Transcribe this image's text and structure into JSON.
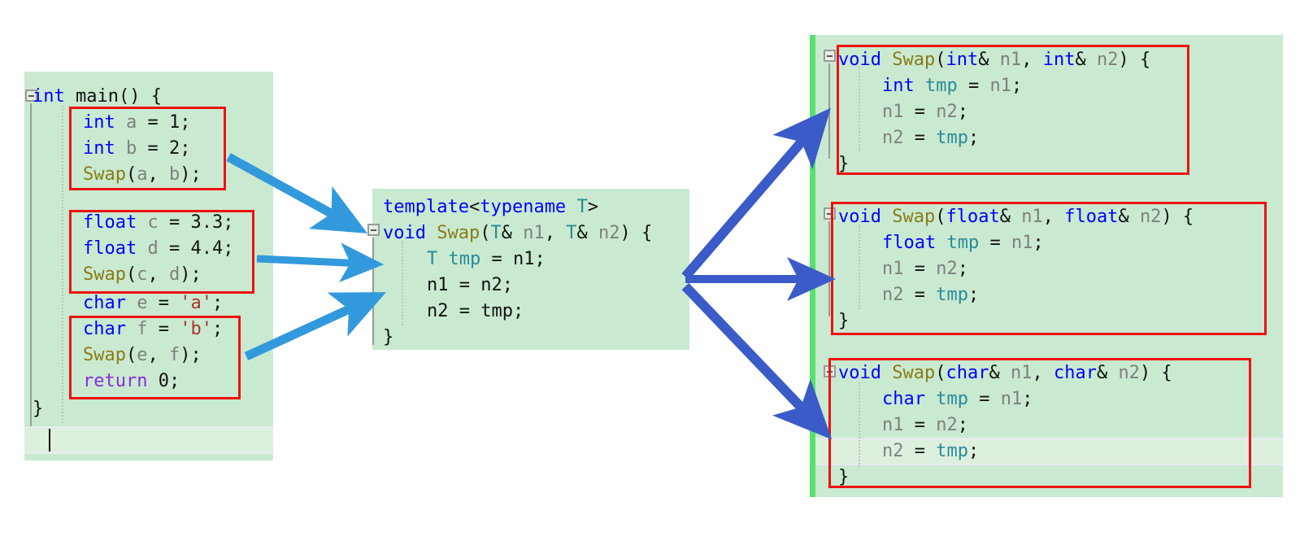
{
  "diagram": {
    "title": "C++ function template instantiation diagram",
    "colors": {
      "editor_background": "#c9ead0",
      "highlight_row": "#ddf0de",
      "red_box_border": "#ee1111",
      "left_arrow": "#3399dd",
      "right_arrow": "#3a5bc8",
      "change_marker_green": "#57e26d",
      "keyword_blue": "#0000ff",
      "function_olive": "#8a7b18",
      "variable_gray": "#808080",
      "type_teal": "#2b8a99",
      "string_red": "#b03030",
      "return_purple": "#8a2be2"
    }
  },
  "left_panel": {
    "name": "main-function-editor",
    "lines": [
      {
        "id": "l0",
        "indent": 0,
        "tokens": [
          {
            "t": "int",
            "c": "kw"
          },
          {
            "t": " main() {",
            "c": "pun"
          }
        ]
      },
      {
        "id": "l1",
        "indent": 1,
        "tokens": [
          {
            "t": "int",
            "c": "kw"
          },
          {
            "t": " ",
            "c": "pun"
          },
          {
            "t": "a",
            "c": "var"
          },
          {
            "t": " = ",
            "c": "pun"
          },
          {
            "t": "1",
            "c": "num"
          },
          {
            "t": ";",
            "c": "pun"
          }
        ]
      },
      {
        "id": "l2",
        "indent": 1,
        "tokens": [
          {
            "t": "int",
            "c": "kw"
          },
          {
            "t": " ",
            "c": "pun"
          },
          {
            "t": "b",
            "c": "var"
          },
          {
            "t": " = ",
            "c": "pun"
          },
          {
            "t": "2",
            "c": "num"
          },
          {
            "t": ";",
            "c": "pun"
          }
        ]
      },
      {
        "id": "l3",
        "indent": 1,
        "tokens": [
          {
            "t": "Swap",
            "c": "fn"
          },
          {
            "t": "(",
            "c": "pun"
          },
          {
            "t": "a",
            "c": "var"
          },
          {
            "t": ", ",
            "c": "pun"
          },
          {
            "t": "b",
            "c": "var"
          },
          {
            "t": ");",
            "c": "pun"
          }
        ]
      },
      {
        "id": "l4",
        "indent": 1,
        "tokens": [
          {
            "t": "float",
            "c": "kw"
          },
          {
            "t": " ",
            "c": "pun"
          },
          {
            "t": "c",
            "c": "var"
          },
          {
            "t": " = ",
            "c": "pun"
          },
          {
            "t": "3.3",
            "c": "num"
          },
          {
            "t": ";",
            "c": "pun"
          }
        ]
      },
      {
        "id": "l5",
        "indent": 1,
        "tokens": [
          {
            "t": "float",
            "c": "kw"
          },
          {
            "t": " ",
            "c": "pun"
          },
          {
            "t": "d",
            "c": "var"
          },
          {
            "t": " = ",
            "c": "pun"
          },
          {
            "t": "4.4",
            "c": "num"
          },
          {
            "t": ";",
            "c": "pun"
          }
        ]
      },
      {
        "id": "l6",
        "indent": 1,
        "tokens": [
          {
            "t": "Swap",
            "c": "fn"
          },
          {
            "t": "(",
            "c": "pun"
          },
          {
            "t": "c",
            "c": "var"
          },
          {
            "t": ", ",
            "c": "pun"
          },
          {
            "t": "d",
            "c": "var"
          },
          {
            "t": ");",
            "c": "pun"
          }
        ]
      },
      {
        "id": "l7",
        "indent": 1,
        "tokens": [
          {
            "t": "char",
            "c": "kw"
          },
          {
            "t": " ",
            "c": "pun"
          },
          {
            "t": "e",
            "c": "var"
          },
          {
            "t": " = ",
            "c": "pun"
          },
          {
            "t": "'a'",
            "c": "str"
          },
          {
            "t": ";",
            "c": "pun"
          }
        ]
      },
      {
        "id": "l8",
        "indent": 1,
        "tokens": [
          {
            "t": "char",
            "c": "kw"
          },
          {
            "t": " ",
            "c": "pun"
          },
          {
            "t": "f",
            "c": "var"
          },
          {
            "t": " = ",
            "c": "pun"
          },
          {
            "t": "'b'",
            "c": "str"
          },
          {
            "t": ";",
            "c": "pun"
          }
        ]
      },
      {
        "id": "l9",
        "indent": 1,
        "tokens": [
          {
            "t": "Swap",
            "c": "fn"
          },
          {
            "t": "(",
            "c": "pun"
          },
          {
            "t": "e",
            "c": "var"
          },
          {
            "t": ", ",
            "c": "pun"
          },
          {
            "t": "f",
            "c": "var"
          },
          {
            "t": ");",
            "c": "pun"
          }
        ]
      },
      {
        "id": "l10",
        "indent": 1,
        "tokens": [
          {
            "t": "return",
            "c": "ret"
          },
          {
            "t": " ",
            "c": "pun"
          },
          {
            "t": "0",
            "c": "num"
          },
          {
            "t": ";",
            "c": "pun"
          }
        ]
      },
      {
        "id": "l11",
        "indent": 0,
        "tokens": [
          {
            "t": "}",
            "c": "pun"
          }
        ]
      }
    ],
    "plain_text": [
      "int main() {",
      "    int a = 1;",
      "    int b = 2;",
      "    Swap(a, b);",
      "    float c = 3.3;",
      "    float d = 4.4;",
      "    Swap(c, d);",
      "    char e = 'a';",
      "    char f = 'b';",
      "    Swap(e, f);",
      "    return 0;",
      "}"
    ],
    "highlight_boxes": [
      {
        "name": "int-call-group",
        "label": "int a = 1; int b = 2; Swap(a, b);"
      },
      {
        "name": "float-call-group",
        "label": "float c = 3.3; float d = 4.4; Swap(c, d);"
      },
      {
        "name": "char-call-group",
        "label": "char e = 'a'; char f = 'b'; Swap(e, f);"
      }
    ]
  },
  "center_panel": {
    "name": "swap-template-editor",
    "lines": [
      {
        "id": "c0",
        "indent": 0,
        "tokens": [
          {
            "t": "template",
            "c": "kw"
          },
          {
            "t": "<",
            "c": "pun"
          },
          {
            "t": "typename",
            "c": "kw"
          },
          {
            "t": " ",
            "c": "pun"
          },
          {
            "t": "T",
            "c": "type"
          },
          {
            "t": ">",
            "c": "pun"
          }
        ]
      },
      {
        "id": "c1",
        "indent": 0,
        "tokens": [
          {
            "t": "void",
            "c": "kw"
          },
          {
            "t": " ",
            "c": "pun"
          },
          {
            "t": "Swap",
            "c": "fn"
          },
          {
            "t": "(",
            "c": "pun"
          },
          {
            "t": "T",
            "c": "type"
          },
          {
            "t": "& ",
            "c": "pun"
          },
          {
            "t": "n1",
            "c": "var"
          },
          {
            "t": ", ",
            "c": "pun"
          },
          {
            "t": "T",
            "c": "type"
          },
          {
            "t": "& ",
            "c": "pun"
          },
          {
            "t": "n2",
            "c": "var"
          },
          {
            "t": ") {",
            "c": "pun"
          }
        ]
      },
      {
        "id": "c2",
        "indent": 1,
        "tokens": [
          {
            "t": "T",
            "c": "type"
          },
          {
            "t": " ",
            "c": "pun"
          },
          {
            "t": "tmp",
            "c": "type"
          },
          {
            "t": " = ",
            "c": "pun"
          },
          {
            "t": "n1",
            "c": "pun"
          },
          {
            "t": ";",
            "c": "pun"
          }
        ]
      },
      {
        "id": "c3",
        "indent": 1,
        "tokens": [
          {
            "t": "n1",
            "c": "pun"
          },
          {
            "t": " = ",
            "c": "pun"
          },
          {
            "t": "n2",
            "c": "pun"
          },
          {
            "t": ";",
            "c": "pun"
          }
        ]
      },
      {
        "id": "c4",
        "indent": 1,
        "tokens": [
          {
            "t": "n2",
            "c": "pun"
          },
          {
            "t": " = ",
            "c": "pun"
          },
          {
            "t": "tmp",
            "c": "pun"
          },
          {
            "t": ";",
            "c": "pun"
          }
        ]
      },
      {
        "id": "c5",
        "indent": 0,
        "tokens": [
          {
            "t": "}",
            "c": "pun"
          }
        ]
      }
    ],
    "plain_text": [
      "template<typename T>",
      "void Swap(T& n1, T& n2) {",
      "    T tmp = n1;",
      "    n1 = n2;",
      "    n2 = tmp;",
      "}"
    ]
  },
  "right_panel": {
    "name": "instantiated-functions-editor",
    "blocks": [
      {
        "name": "swap-int-instantiation",
        "type_name": "int",
        "lines": [
          {
            "id": "r0a",
            "indent": 0,
            "tokens": [
              {
                "t": "void",
                "c": "kw"
              },
              {
                "t": " ",
                "c": "pun"
              },
              {
                "t": "Swap",
                "c": "fn"
              },
              {
                "t": "(",
                "c": "pun"
              },
              {
                "t": "int",
                "c": "kw"
              },
              {
                "t": "& ",
                "c": "pun"
              },
              {
                "t": "n1",
                "c": "var"
              },
              {
                "t": ", ",
                "c": "pun"
              },
              {
                "t": "int",
                "c": "kw"
              },
              {
                "t": "& ",
                "c": "pun"
              },
              {
                "t": "n2",
                "c": "var"
              },
              {
                "t": ") {",
                "c": "pun"
              }
            ]
          },
          {
            "id": "r0b",
            "indent": 1,
            "tokens": [
              {
                "t": "int",
                "c": "kw"
              },
              {
                "t": " ",
                "c": "pun"
              },
              {
                "t": "tmp",
                "c": "type"
              },
              {
                "t": " = ",
                "c": "pun"
              },
              {
                "t": "n1",
                "c": "var"
              },
              {
                "t": ";",
                "c": "pun"
              }
            ]
          },
          {
            "id": "r0c",
            "indent": 1,
            "tokens": [
              {
                "t": "n1",
                "c": "var"
              },
              {
                "t": " = ",
                "c": "pun"
              },
              {
                "t": "n2",
                "c": "var"
              },
              {
                "t": ";",
                "c": "pun"
              }
            ]
          },
          {
            "id": "r0d",
            "indent": 1,
            "tokens": [
              {
                "t": "n2",
                "c": "var"
              },
              {
                "t": " = ",
                "c": "pun"
              },
              {
                "t": "tmp",
                "c": "type"
              },
              {
                "t": ";",
                "c": "pun"
              }
            ]
          },
          {
            "id": "r0e",
            "indent": 0,
            "tokens": [
              {
                "t": "}",
                "c": "pun"
              }
            ]
          }
        ],
        "plain_text": [
          "void Swap(int& n1, int& n2) {",
          "    int tmp = n1;",
          "    n1 = n2;",
          "    n2 = tmp;",
          "}"
        ]
      },
      {
        "name": "swap-float-instantiation",
        "type_name": "float",
        "lines": [
          {
            "id": "r1a",
            "indent": 0,
            "tokens": [
              {
                "t": "void",
                "c": "kw"
              },
              {
                "t": " ",
                "c": "pun"
              },
              {
                "t": "Swap",
                "c": "fn"
              },
              {
                "t": "(",
                "c": "pun"
              },
              {
                "t": "float",
                "c": "kw"
              },
              {
                "t": "& ",
                "c": "pun"
              },
              {
                "t": "n1",
                "c": "var"
              },
              {
                "t": ", ",
                "c": "pun"
              },
              {
                "t": "float",
                "c": "kw"
              },
              {
                "t": "& ",
                "c": "pun"
              },
              {
                "t": "n2",
                "c": "var"
              },
              {
                "t": ") {",
                "c": "pun"
              }
            ]
          },
          {
            "id": "r1b",
            "indent": 1,
            "tokens": [
              {
                "t": "float",
                "c": "kw"
              },
              {
                "t": " ",
                "c": "pun"
              },
              {
                "t": "tmp",
                "c": "type"
              },
              {
                "t": " = ",
                "c": "pun"
              },
              {
                "t": "n1",
                "c": "var"
              },
              {
                "t": ";",
                "c": "pun"
              }
            ]
          },
          {
            "id": "r1c",
            "indent": 1,
            "tokens": [
              {
                "t": "n1",
                "c": "var"
              },
              {
                "t": " = ",
                "c": "pun"
              },
              {
                "t": "n2",
                "c": "var"
              },
              {
                "t": ";",
                "c": "pun"
              }
            ]
          },
          {
            "id": "r1d",
            "indent": 1,
            "tokens": [
              {
                "t": "n2",
                "c": "var"
              },
              {
                "t": " = ",
                "c": "pun"
              },
              {
                "t": "tmp",
                "c": "type"
              },
              {
                "t": ";",
                "c": "pun"
              }
            ]
          },
          {
            "id": "r1e",
            "indent": 0,
            "tokens": [
              {
                "t": "}",
                "c": "pun"
              }
            ]
          }
        ],
        "plain_text": [
          "void Swap(float& n1, float& n2) {",
          "    float tmp = n1;",
          "    n1 = n2;",
          "    n2 = tmp;",
          "}"
        ]
      },
      {
        "name": "swap-char-instantiation",
        "type_name": "char",
        "highlighted_line_id": "r2d",
        "lines": [
          {
            "id": "r2a",
            "indent": 0,
            "tokens": [
              {
                "t": "void",
                "c": "kw"
              },
              {
                "t": " ",
                "c": "pun"
              },
              {
                "t": "Swap",
                "c": "fn"
              },
              {
                "t": "(",
                "c": "pun"
              },
              {
                "t": "char",
                "c": "kw"
              },
              {
                "t": "& ",
                "c": "pun"
              },
              {
                "t": "n1",
                "c": "var"
              },
              {
                "t": ", ",
                "c": "pun"
              },
              {
                "t": "char",
                "c": "kw"
              },
              {
                "t": "& ",
                "c": "pun"
              },
              {
                "t": "n2",
                "c": "var"
              },
              {
                "t": ") {",
                "c": "pun"
              }
            ]
          },
          {
            "id": "r2b",
            "indent": 1,
            "tokens": [
              {
                "t": "char",
                "c": "kw"
              },
              {
                "t": " ",
                "c": "pun"
              },
              {
                "t": "tmp",
                "c": "type"
              },
              {
                "t": " = ",
                "c": "pun"
              },
              {
                "t": "n1",
                "c": "var"
              },
              {
                "t": ";",
                "c": "pun"
              }
            ]
          },
          {
            "id": "r2c",
            "indent": 1,
            "tokens": [
              {
                "t": "n1",
                "c": "var"
              },
              {
                "t": " = ",
                "c": "pun"
              },
              {
                "t": "n2",
                "c": "var"
              },
              {
                "t": ";",
                "c": "pun"
              }
            ]
          },
          {
            "id": "r2d",
            "indent": 1,
            "tokens": [
              {
                "t": "n2",
                "c": "var"
              },
              {
                "t": " = ",
                "c": "pun"
              },
              {
                "t": "tmp",
                "c": "type"
              },
              {
                "t": ";",
                "c": "pun"
              }
            ]
          },
          {
            "id": "r2e",
            "indent": 0,
            "tokens": [
              {
                "t": "}",
                "c": "pun"
              }
            ]
          }
        ],
        "plain_text": [
          "void Swap(char& n1, char& n2) {",
          "    char tmp = n1;",
          "    n1 = n2;",
          "    n2 = tmp;",
          "}"
        ]
      }
    ]
  },
  "arrows": {
    "left_group": {
      "name": "calls-to-template-arrows",
      "color": "#3399dd",
      "count": 3,
      "from": "main-function-call-groups",
      "to": "swap-template-editor"
    },
    "right_group": {
      "name": "template-to-instantiations-arrows",
      "color": "#3a5bc8",
      "count": 3,
      "from": "swap-template-editor",
      "to": "instantiated-functions-editor"
    }
  }
}
